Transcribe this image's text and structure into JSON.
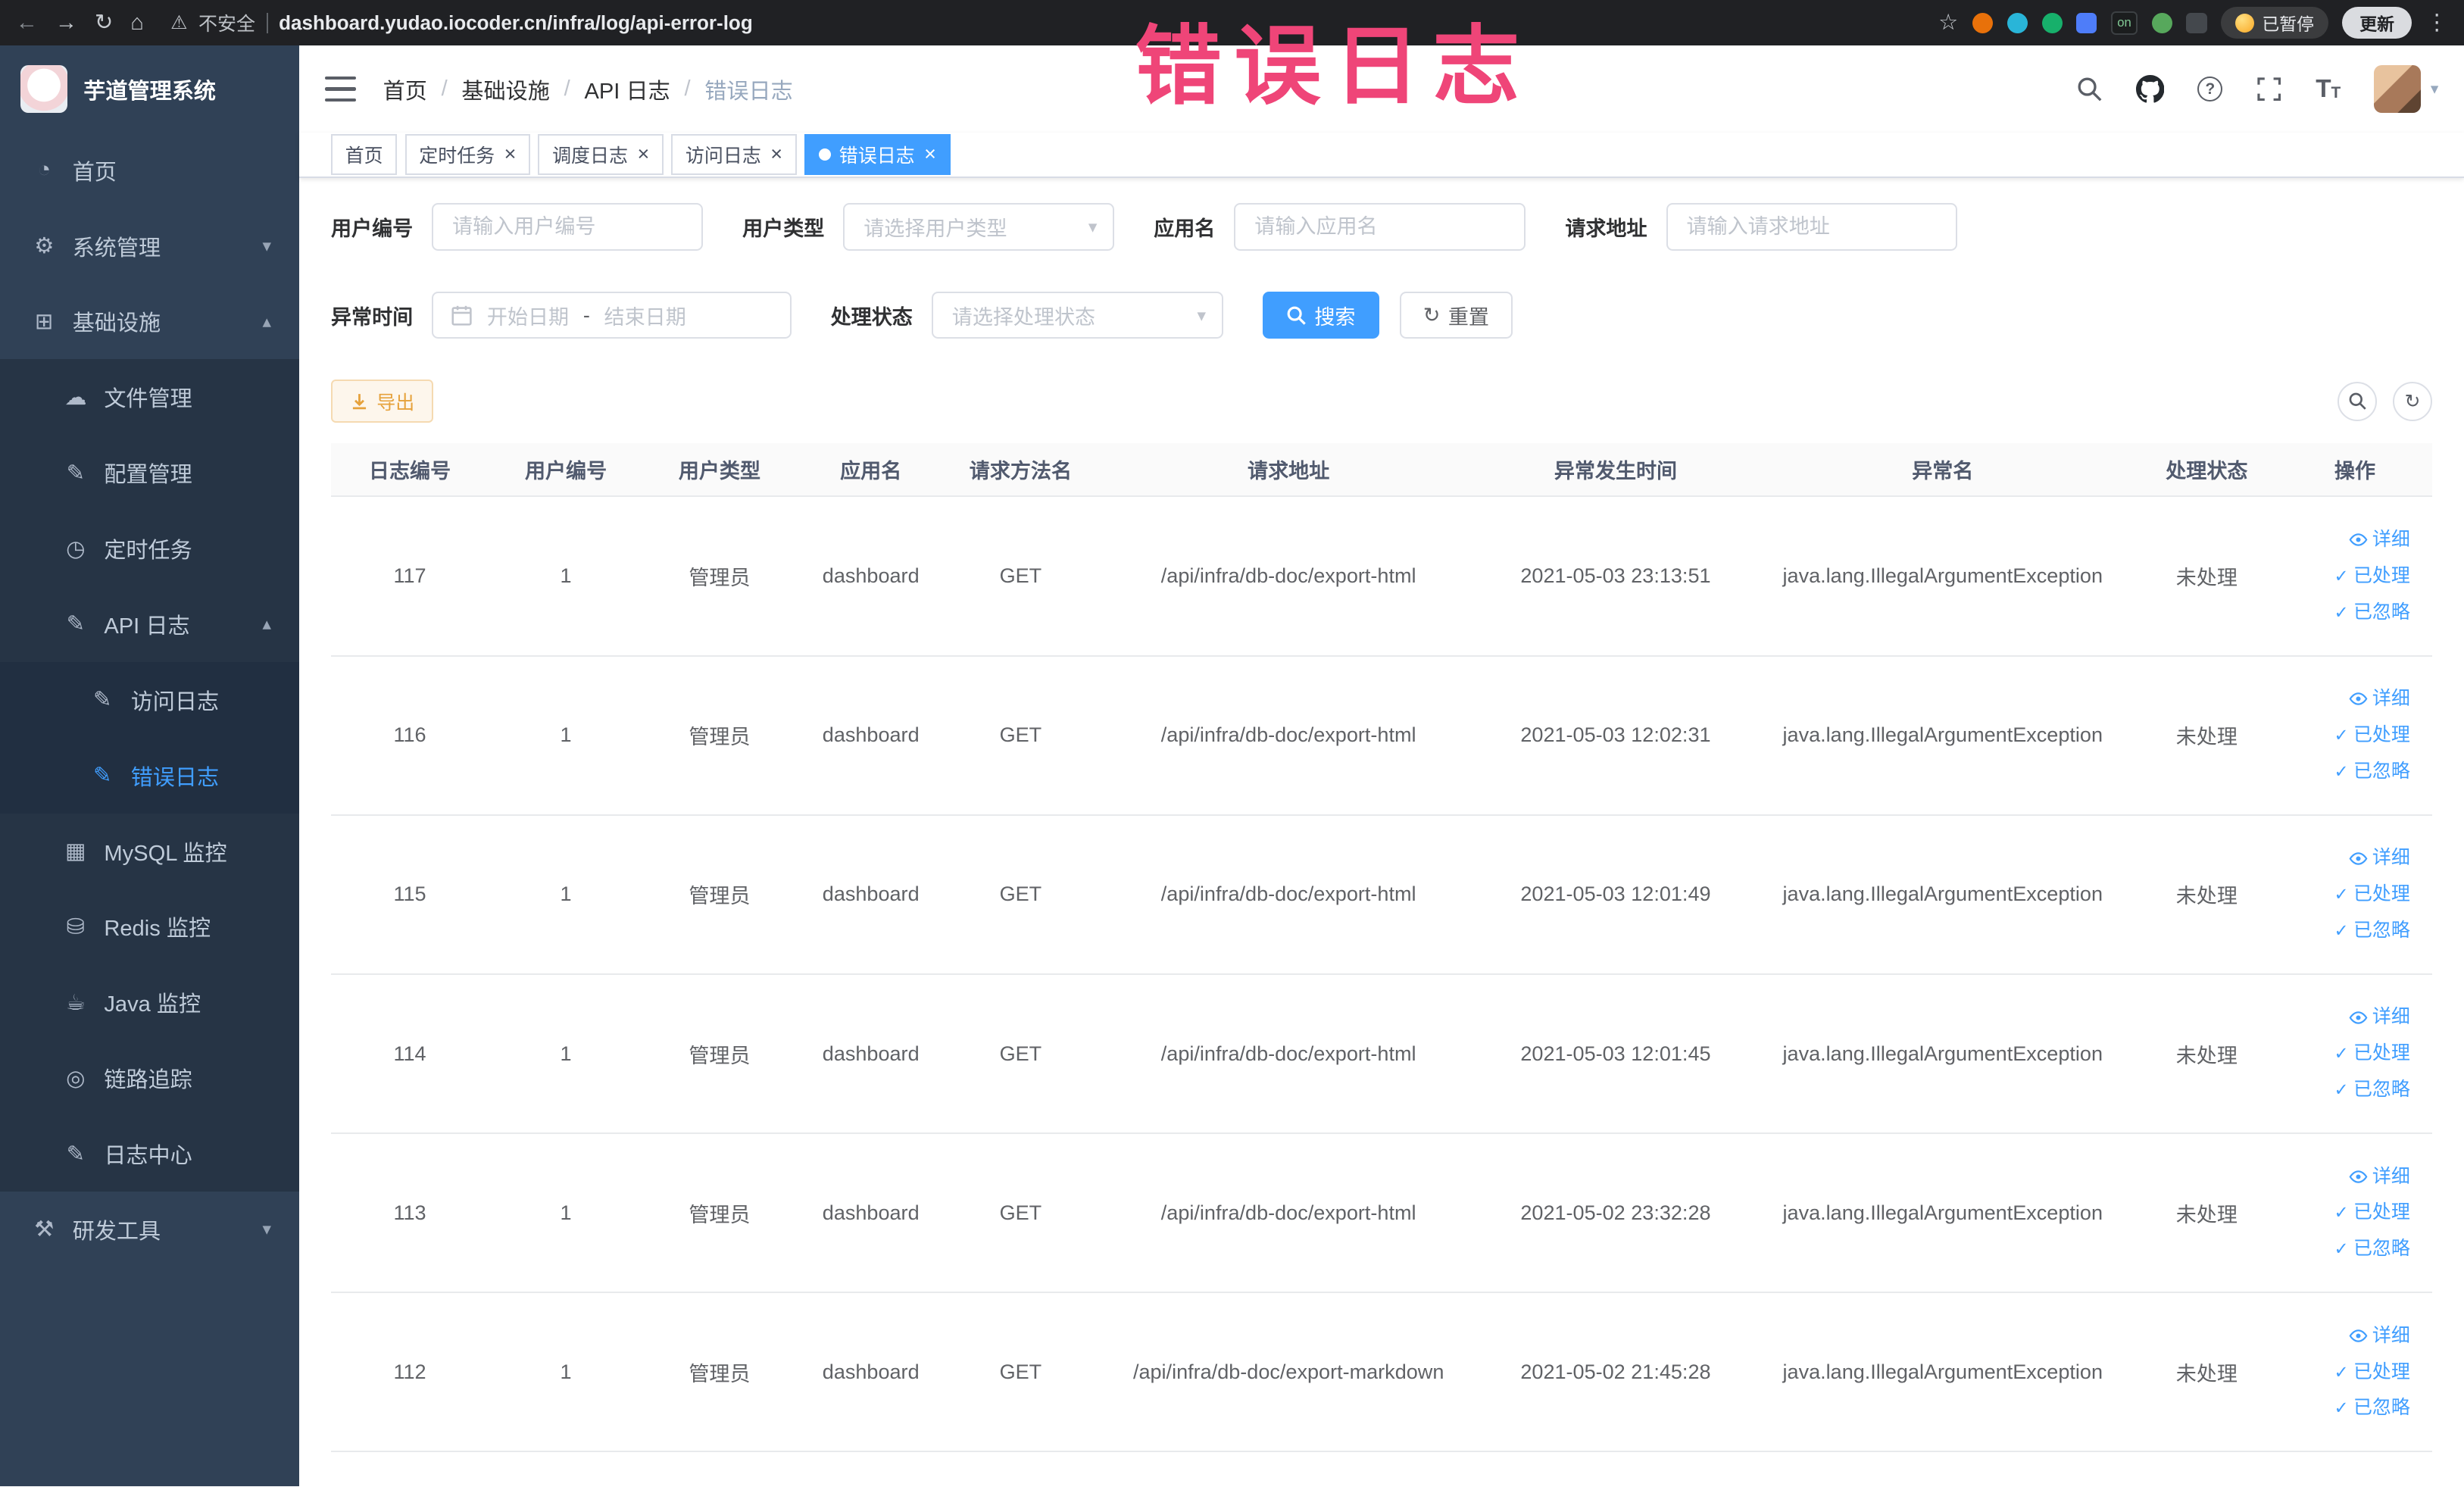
{
  "colors": {
    "accent": "#409eff",
    "warning": "#e6a23c",
    "sidebar_bg": "#304156",
    "annotation": "#ef4578"
  },
  "icons": {
    "back": "←",
    "forward": "→",
    "reload": "↻",
    "home": "⌂",
    "warning": "⚠",
    "star": "☆",
    "overflow": "⋮",
    "question": "?",
    "caret_down": "▾",
    "collapse_arrow": "▴",
    "expand_arrow": "▾",
    "close": "×",
    "check": "✓",
    "refresh": "↻",
    "menu_home": "◔",
    "menu_system": "⚙",
    "menu_infra": "⊞",
    "menu_file": "☁",
    "menu_config": "✎",
    "menu_job": "◷",
    "menu_api_log": "✎",
    "menu_access_log": "✎",
    "menu_error_log": "✎",
    "menu_mysql": "▦",
    "menu_redis": "⛁",
    "menu_java": "☕",
    "menu_trace": "◎",
    "menu_log_center": "✎",
    "menu_dev_tools": "⚒"
  },
  "browser": {
    "security_label": "不安全",
    "url": "dashboard.yudao.iocoder.cn/infra/log/api-error-log",
    "extension_on_badge": "on",
    "paused_badge": "已暂停",
    "update_button": "更新"
  },
  "annotation": {
    "text": "错误日志"
  },
  "sidebar": {
    "logo_title": "芋道管理系统",
    "items": [
      "首页",
      "系统管理",
      "基础设施",
      "文件管理",
      "配置管理",
      "定时任务",
      "API 日志",
      "访问日志",
      "错误日志",
      "MySQL 监控",
      "Redis 监控",
      "Java 监控",
      "链路追踪",
      "日志中心",
      "研发工具"
    ]
  },
  "header": {
    "breadcrumb": [
      "首页",
      "基础设施",
      "API 日志",
      "错误日志"
    ],
    "breadcrumb_separator": "/"
  },
  "tabs": [
    "首页",
    "定时任务",
    "调度日志",
    "访问日志",
    "错误日志"
  ],
  "filters": {
    "user_id": {
      "label": "用户编号",
      "placeholder": "请输入用户编号"
    },
    "user_type": {
      "label": "用户类型",
      "placeholder": "请选择用户类型"
    },
    "app_name": {
      "label": "应用名",
      "placeholder": "请输入应用名"
    },
    "request_url": {
      "label": "请求地址",
      "placeholder": "请输入请求地址"
    },
    "exception_time": {
      "label": "异常时间",
      "start_placeholder": "开始日期",
      "separator": "-",
      "end_placeholder": "结束日期"
    },
    "process_status": {
      "label": "处理状态",
      "placeholder": "请选择处理状态"
    },
    "search_label": "搜索",
    "reset_label": "重置"
  },
  "toolbar": {
    "export_label": "导出"
  },
  "table": {
    "headers": [
      "日志编号",
      "用户编号",
      "用户类型",
      "应用名",
      "请求方法名",
      "请求地址",
      "异常发生时间",
      "异常名",
      "处理状态",
      "操作"
    ],
    "actions": {
      "detail": "详细",
      "processed": "已处理",
      "ignored": "已忽略"
    },
    "rows": [
      {
        "log_id": "117",
        "user_id": "1",
        "user_type": "管理员",
        "app_name": "dashboard",
        "method": "GET",
        "url": "/api/infra/db-doc/export-html",
        "time": "2021-05-03 23:13:51",
        "exception": "java.lang.IllegalArgumentException",
        "status": "未处理"
      },
      {
        "log_id": "116",
        "user_id": "1",
        "user_type": "管理员",
        "app_name": "dashboard",
        "method": "GET",
        "url": "/api/infra/db-doc/export-html",
        "time": "2021-05-03 12:02:31",
        "exception": "java.lang.IllegalArgumentException",
        "status": "未处理"
      },
      {
        "log_id": "115",
        "user_id": "1",
        "user_type": "管理员",
        "app_name": "dashboard",
        "method": "GET",
        "url": "/api/infra/db-doc/export-html",
        "time": "2021-05-03 12:01:49",
        "exception": "java.lang.IllegalArgumentException",
        "status": "未处理"
      },
      {
        "log_id": "114",
        "user_id": "1",
        "user_type": "管理员",
        "app_name": "dashboard",
        "method": "GET",
        "url": "/api/infra/db-doc/export-html",
        "time": "2021-05-03 12:01:45",
        "exception": "java.lang.IllegalArgumentException",
        "status": "未处理"
      },
      {
        "log_id": "113",
        "user_id": "1",
        "user_type": "管理员",
        "app_name": "dashboard",
        "method": "GET",
        "url": "/api/infra/db-doc/export-html",
        "time": "2021-05-02 23:32:28",
        "exception": "java.lang.IllegalArgumentException",
        "status": "未处理"
      },
      {
        "log_id": "112",
        "user_id": "1",
        "user_type": "管理员",
        "app_name": "dashboard",
        "method": "GET",
        "url": "/api/infra/db-doc/export-markdown",
        "time": "2021-05-02 21:45:28",
        "exception": "java.lang.IllegalArgumentException",
        "status": "未处理"
      }
    ]
  }
}
